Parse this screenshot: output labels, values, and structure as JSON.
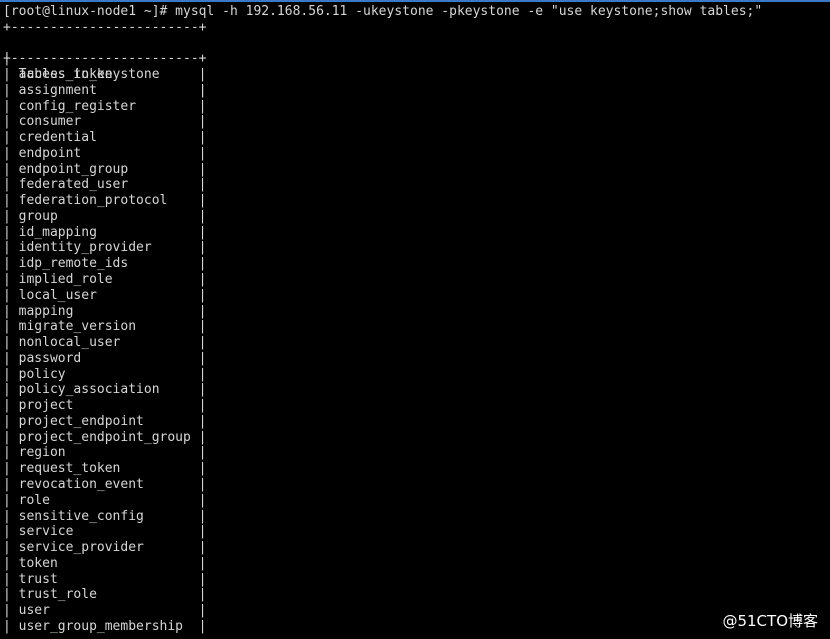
{
  "terminal": {
    "command_line": "[root@linux-node1 ~]# mysql -h 192.168.56.11 -ukeystone -pkeystone -e \"use keystone;show tables;\"",
    "border": "+------------------------+",
    "pipe": "|",
    "column_header": "Tables_in_keystone",
    "rows": [
      "access_token",
      "assignment",
      "config_register",
      "consumer",
      "credential",
      "endpoint",
      "endpoint_group",
      "federated_user",
      "federation_protocol",
      "group",
      "id_mapping",
      "identity_provider",
      "idp_remote_ids",
      "implied_role",
      "local_user",
      "mapping",
      "migrate_version",
      "nonlocal_user",
      "password",
      "policy",
      "policy_association",
      "project",
      "project_endpoint",
      "project_endpoint_group",
      "region",
      "request_token",
      "revocation_event",
      "role",
      "sensitive_config",
      "service",
      "service_provider",
      "token",
      "trust",
      "trust_role",
      "user",
      "user_group_membership"
    ]
  },
  "watermark": "@51CTO博客",
  "colors": {
    "background": "#000000",
    "text": "#d6d6d6",
    "top_border": "#3a78c8"
  }
}
